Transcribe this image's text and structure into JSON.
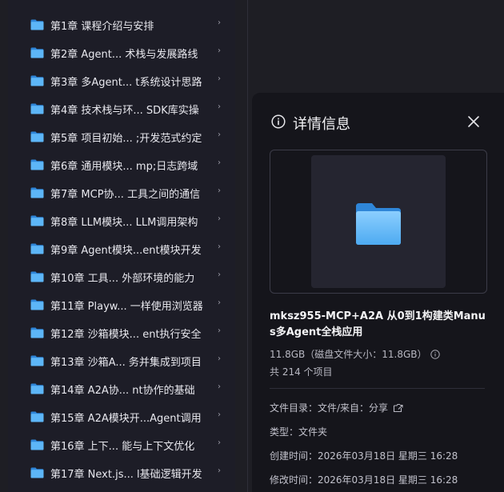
{
  "file_list": [
    {
      "label": "第1章 课程介绍与安排"
    },
    {
      "label": "第2章 Agent... 术栈与发展路线"
    },
    {
      "label": "第3章 多Agent... t系统设计思路"
    },
    {
      "label": "第4章 技术栈与环... SDK库实操"
    },
    {
      "label": "第5章 项目初始... ;开发范式约定"
    },
    {
      "label": "第6章 通用模块... mp;日志跨域"
    },
    {
      "label": "第7章 MCP协... 工具之间的通信"
    },
    {
      "label": "第8章 LLM模块... LLM调用架构"
    },
    {
      "label": "第9章 Agent模块...ent模块开发"
    },
    {
      "label": "第10章 工具... 外部环境的能力"
    },
    {
      "label": "第11章 Playw... 一样使用浏览器"
    },
    {
      "label": "第12章 沙箱模块... ent执行安全"
    },
    {
      "label": "第13章 沙箱A... 务并集成到项目"
    },
    {
      "label": "第14章 A2A协... nt协作的基础"
    },
    {
      "label": "第15章 A2A模块开...Agent调用"
    },
    {
      "label": "第16章 上下... 能与上下文优化"
    },
    {
      "label": "第17章 Next.js... l基础逻辑开发"
    }
  ],
  "chevron": "›",
  "detail": {
    "title": "详情信息",
    "file_name": "mksz955-MCP+A2A 从0到1构建类Manus多Agent全栈应用",
    "size_text": "11.8GB（磁盘文件大小：11.8GB）",
    "count_text": "共 214 个项目",
    "directory": "文件目录：文件/来自：分享",
    "type": "类型：文件夹",
    "created": "创建时间：2026年03月18日 星期三 16:28",
    "modified": "修改时间：2026年03月18日 星期三 16:28"
  },
  "colors": {
    "folder": "#4aa8f0",
    "panel_bg": "#15151b",
    "list_bg": "#1d1d27"
  }
}
